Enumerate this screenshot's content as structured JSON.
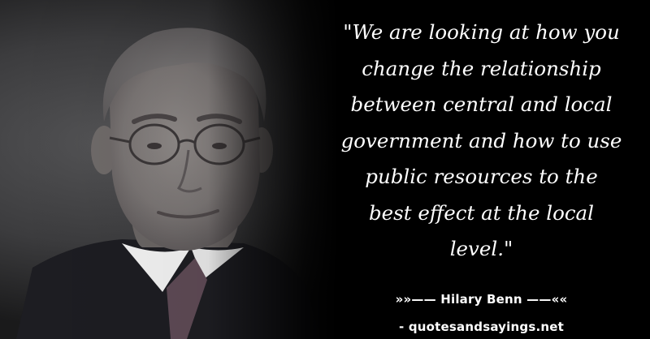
{
  "quote": {
    "lines": [
      "\"We are looking at how you",
      "change the relationship",
      "between central and local",
      "government and how to use",
      "public resources to the",
      "best effect at the local",
      "level.\""
    ]
  },
  "attribution": {
    "text": "»»—— Hilary Benn ——««"
  },
  "source": {
    "text": "- quotesandsayings.net"
  },
  "colors": {
    "background": "#000000",
    "text": "#ffffff",
    "backdrop": "#4a4a4c",
    "jacket": "#1d1d22",
    "shirt": "#ffffff"
  },
  "icons": {
    "portrait": "person-portrait-photo"
  }
}
